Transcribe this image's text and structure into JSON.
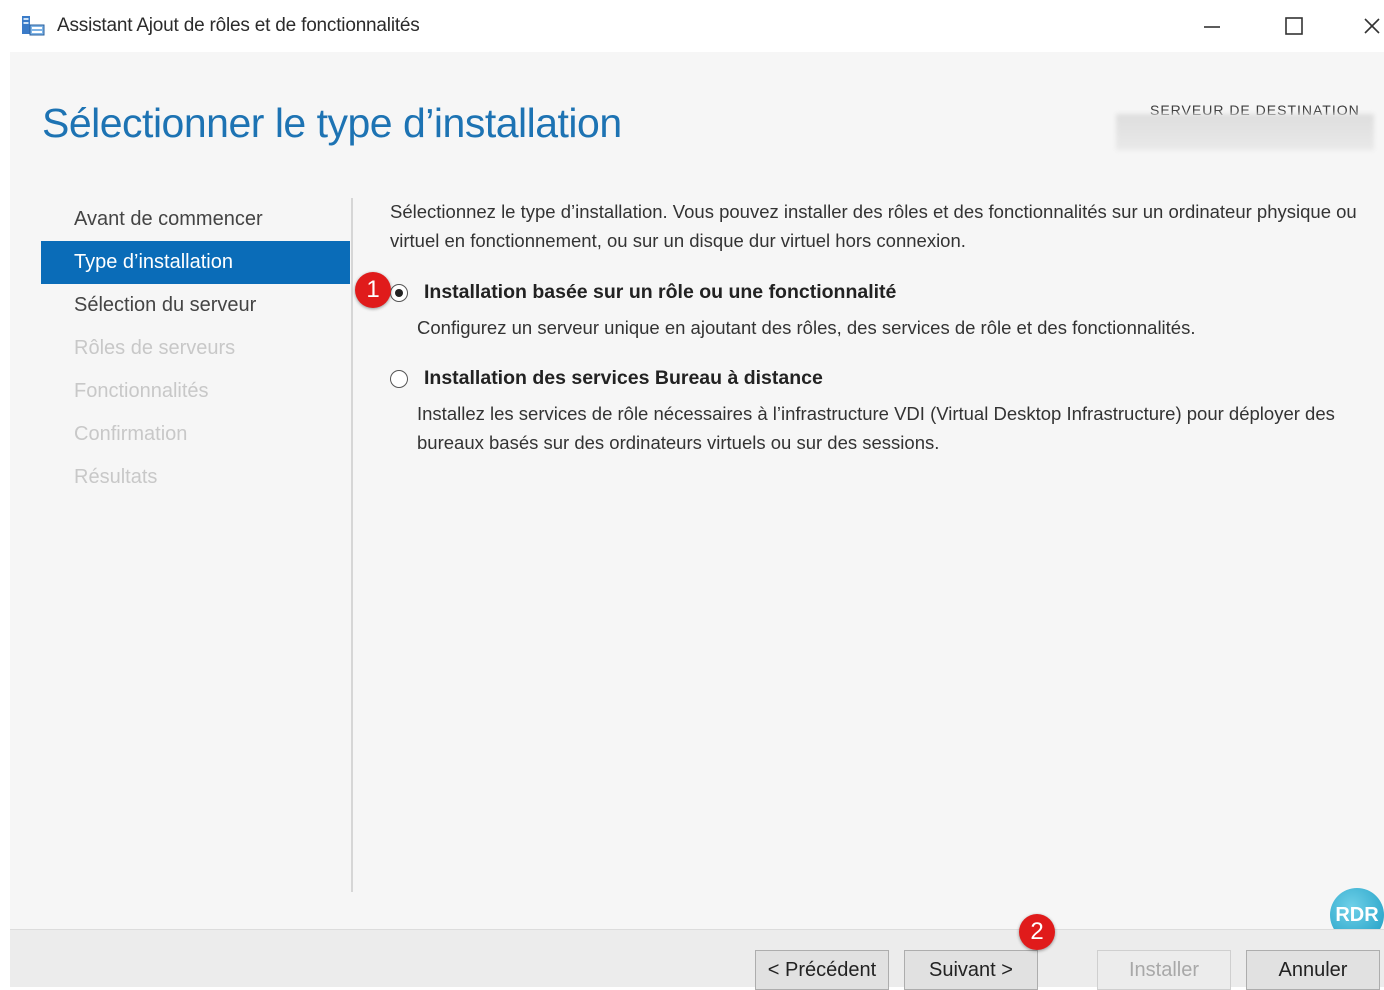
{
  "window": {
    "title": "Assistant Ajout de rôles et de fonctionnalités",
    "icon": "server-manager-icon",
    "controls": [
      "minimize-icon",
      "maximize-icon",
      "close-icon"
    ]
  },
  "header": {
    "page_title": "Sélectionner le type d’installation",
    "destination_label": "SERVEUR DE DESTINATION",
    "destination_value": ""
  },
  "nav": {
    "items": [
      {
        "label": "Avant de commencer",
        "state": "normal"
      },
      {
        "label": "Type d’installation",
        "state": "active"
      },
      {
        "label": "Sélection du serveur",
        "state": "normal"
      },
      {
        "label": "Rôles de serveurs",
        "state": "disabled"
      },
      {
        "label": "Fonctionnalités",
        "state": "disabled"
      },
      {
        "label": "Confirmation",
        "state": "disabled"
      },
      {
        "label": "Résultats",
        "state": "disabled"
      }
    ]
  },
  "content": {
    "intro": "Sélectionnez le type d’installation. Vous pouvez installer des rôles et des fonctionnalités sur un ordinateur physique ou virtuel en fonctionnement, ou sur un disque dur virtuel hors connexion.",
    "options": [
      {
        "title": "Installation basée sur un rôle ou une fonctionnalité",
        "description": "Configurez un serveur unique en ajoutant des rôles, des services de rôle et des fonctionnalités.",
        "selected": true
      },
      {
        "title": "Installation des services Bureau à distance",
        "description": "Installez les services de rôle nécessaires à l’infrastructure VDI (Virtual Desktop Infrastructure) pour déployer des bureaux basés sur des ordinateurs virtuels ou sur des sessions.",
        "selected": false
      }
    ]
  },
  "callouts": {
    "first": "1",
    "second": "2"
  },
  "footer": {
    "previous": "< Précédent",
    "next": "Suivant >",
    "install": "Installer",
    "cancel": "Annuler"
  },
  "watermark": {
    "text": "RDR"
  },
  "colors": {
    "accent": "#0a6cb8",
    "title_blue": "#1d73b3",
    "callout_red": "#e01b1b"
  }
}
